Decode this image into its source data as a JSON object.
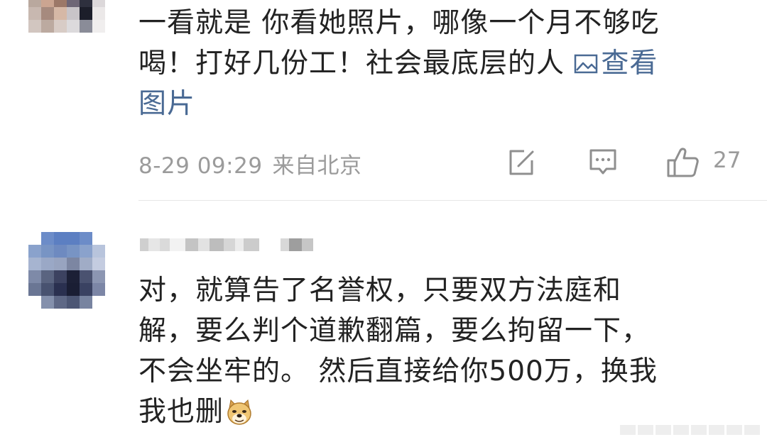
{
  "comments": [
    {
      "text_lines": [
        "一看就是 你看她照片，哪像一个月不够吃",
        "喝！打好几份工！社会最底层的人 "
      ],
      "view_image_label": "查看",
      "view_image_label_2": "图片",
      "timestamp": "8-29 09:29",
      "location": "来自北京",
      "likes": "27",
      "icons": [
        "image-icon",
        "share-icon",
        "comment-icon",
        "like-icon"
      ]
    },
    {
      "text_lines": [
        "对，就算告了名誉权，只要双方法庭和",
        "解，要么判个道歉翻篇，要么拘留一下，",
        "不会坐牢的。 然后直接给你500万，换我",
        "我也删"
      ],
      "emoji": "doge-emoji"
    }
  ],
  "colors": {
    "text": "#222222",
    "meta": "#9b9b9b",
    "link": "#4a6a94",
    "divider": "#e6e6e6"
  }
}
